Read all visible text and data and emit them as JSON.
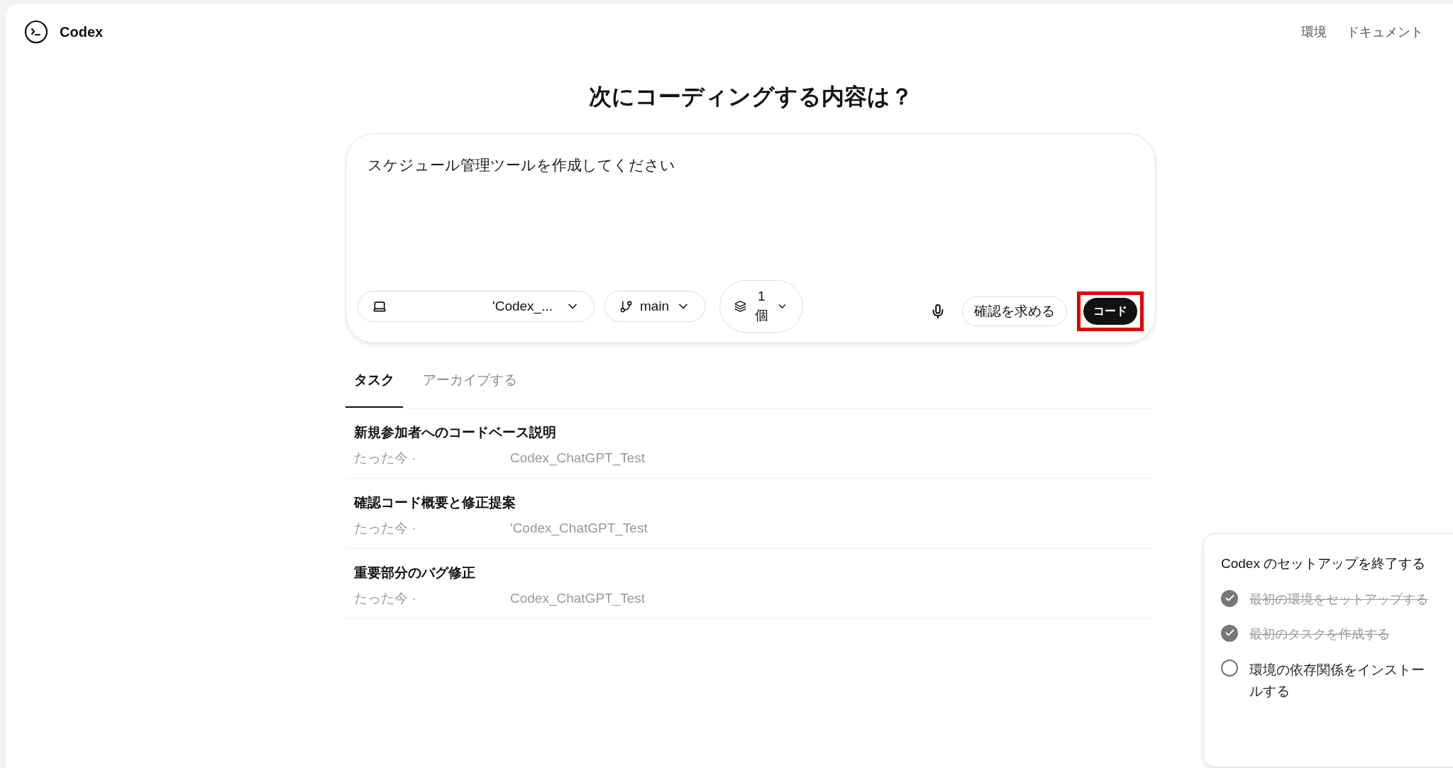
{
  "header": {
    "brand": "Codex",
    "links": [
      "環境",
      "ドキュメント"
    ]
  },
  "heading": "次にコーディングする内容は？",
  "composer": {
    "value": "スケジュール管理ツールを作成してください",
    "repo": "'Codex_...",
    "branch": "main",
    "count": "1 個",
    "ask_button": "確認を求める",
    "code_button": {
      "label": "コード",
      "highlighted": true
    }
  },
  "tabs": [
    {
      "label": "タスク",
      "selected": true
    },
    {
      "label": "アーカイブする",
      "selected": false
    }
  ],
  "tasks": [
    {
      "title": "新規参加者へのコードベース説明",
      "time": "たった今 ·",
      "repo": "Codex_ChatGPT_Test"
    },
    {
      "title": "確認コード概要と修正提案",
      "time": "たった今 ·",
      "repo": "'Codex_ChatGPT_Test"
    },
    {
      "title": "重要部分のバグ修正",
      "time": "たった今 ·",
      "repo": "Codex_ChatGPT_Test"
    }
  ],
  "setup": {
    "title": "Codex のセットアップを終了する",
    "items": [
      {
        "label": "最初の環境をセットアップする",
        "checked": true
      },
      {
        "label": "最初のタスクを作成する",
        "checked": true
      },
      {
        "label": "環境の依存関係をインストールする",
        "checked": false
      }
    ]
  }
}
